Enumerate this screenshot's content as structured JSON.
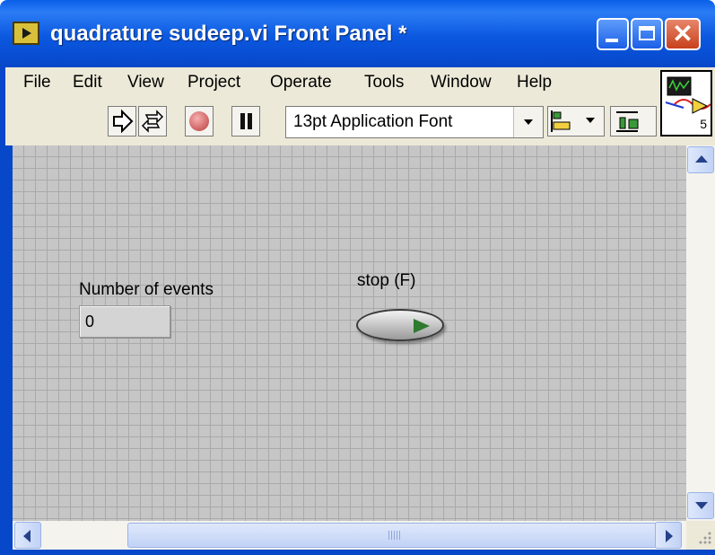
{
  "window": {
    "title": "quadrature sudeep.vi Front Panel *"
  },
  "menu": {
    "items": [
      "File",
      "Edit",
      "View",
      "Project",
      "Operate",
      "Tools",
      "Window",
      "Help"
    ]
  },
  "toolbar": {
    "font_select_value": "13pt Application Font"
  },
  "vi_icon": {
    "label": "5"
  },
  "panel": {
    "numeric_indicator": {
      "label": "Number of events",
      "value": "0"
    },
    "stop_button": {
      "label": "stop (F)"
    }
  },
  "colors": {
    "titlebar": "#0747c9",
    "chrome": "#ece9d8",
    "panel_bg": "#c6c6c6",
    "grid": "#a9a9a9",
    "stop_led": "#2e7a2e"
  }
}
